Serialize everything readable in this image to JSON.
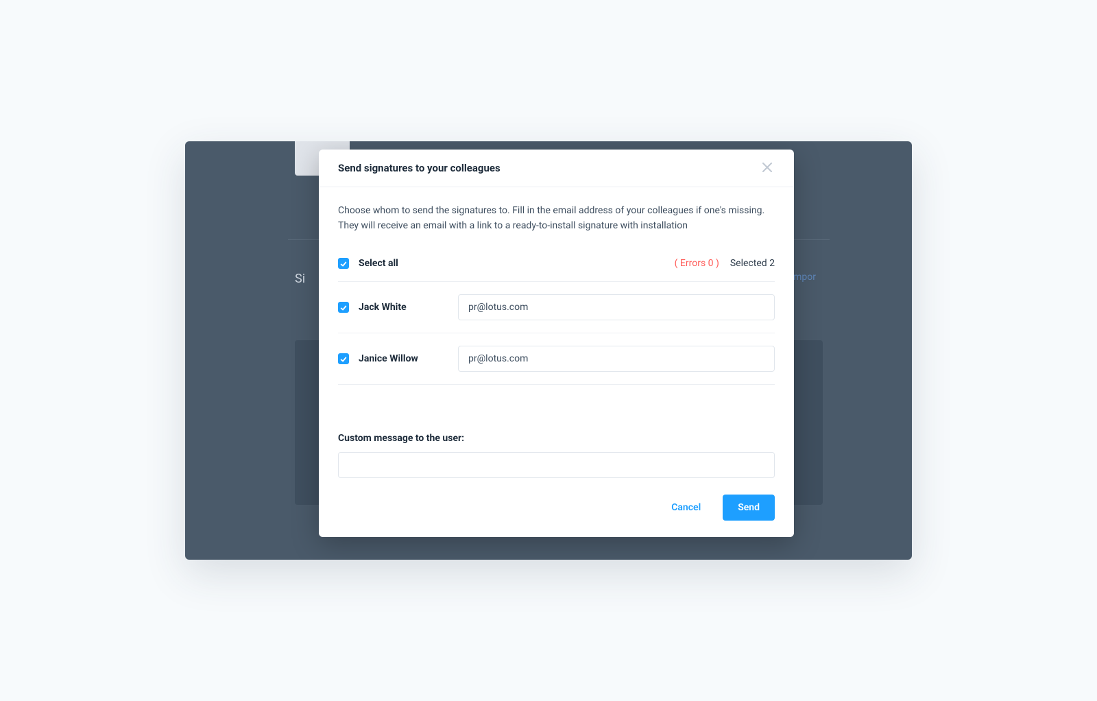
{
  "modal": {
    "title": "Send signatures to your colleagues",
    "description": "Choose whom to send the signatures to. Fill in the email address of your colleagues if one's missing. They will receive an email with a link to a ready-to-install signature with installation",
    "select_all_label": "Select all",
    "errors_label": "( Errors 0 )",
    "selected_label": "Selected 2",
    "custom_message_label": "Custom message to the user:",
    "custom_message_value": "",
    "cancel_label": "Cancel",
    "send_label": "Send"
  },
  "rows": [
    {
      "name": "Jack White",
      "email": "pr@lotus.com",
      "checked": true
    },
    {
      "name": "Janice Willow",
      "email": "pr@lotus.com",
      "checked": true
    }
  ],
  "background": {
    "left_text": "Si",
    "right_text": "mpor"
  }
}
